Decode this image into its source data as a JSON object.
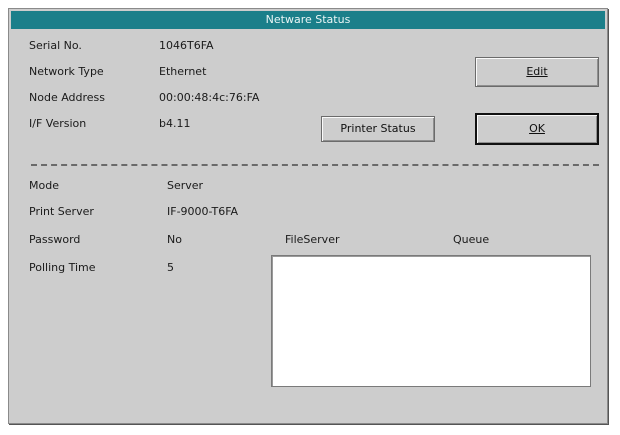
{
  "window": {
    "title": "Netware Status"
  },
  "adapter": {
    "serial_label": "Serial No.",
    "serial_value": "1046T6FA",
    "network_type_label": "Network Type",
    "network_type_value": "Ethernet",
    "node_address_label": "Node Address",
    "node_address_value": "00:00:48:4c:76:FA",
    "version_label": "I/F Version",
    "version_value": "b4.11"
  },
  "netware": {
    "mode_label": "Mode",
    "mode_value": "Server",
    "print_server_label": "Print Server",
    "print_server_value": "IF-9000-T6FA",
    "password_label": "Password",
    "password_value": "No",
    "polling_time_label": "Polling Time",
    "polling_time_value": "5"
  },
  "queue_table": {
    "col_fileserver": "FileServer",
    "col_queue": "Queue",
    "rows": []
  },
  "buttons": {
    "edit_label": "Edit",
    "printer_status_label": "Printer Status",
    "ok_label": "OK"
  },
  "colors": {
    "title_bar": "#1b7f8a",
    "dialog_bg": "#cdcdcd"
  }
}
